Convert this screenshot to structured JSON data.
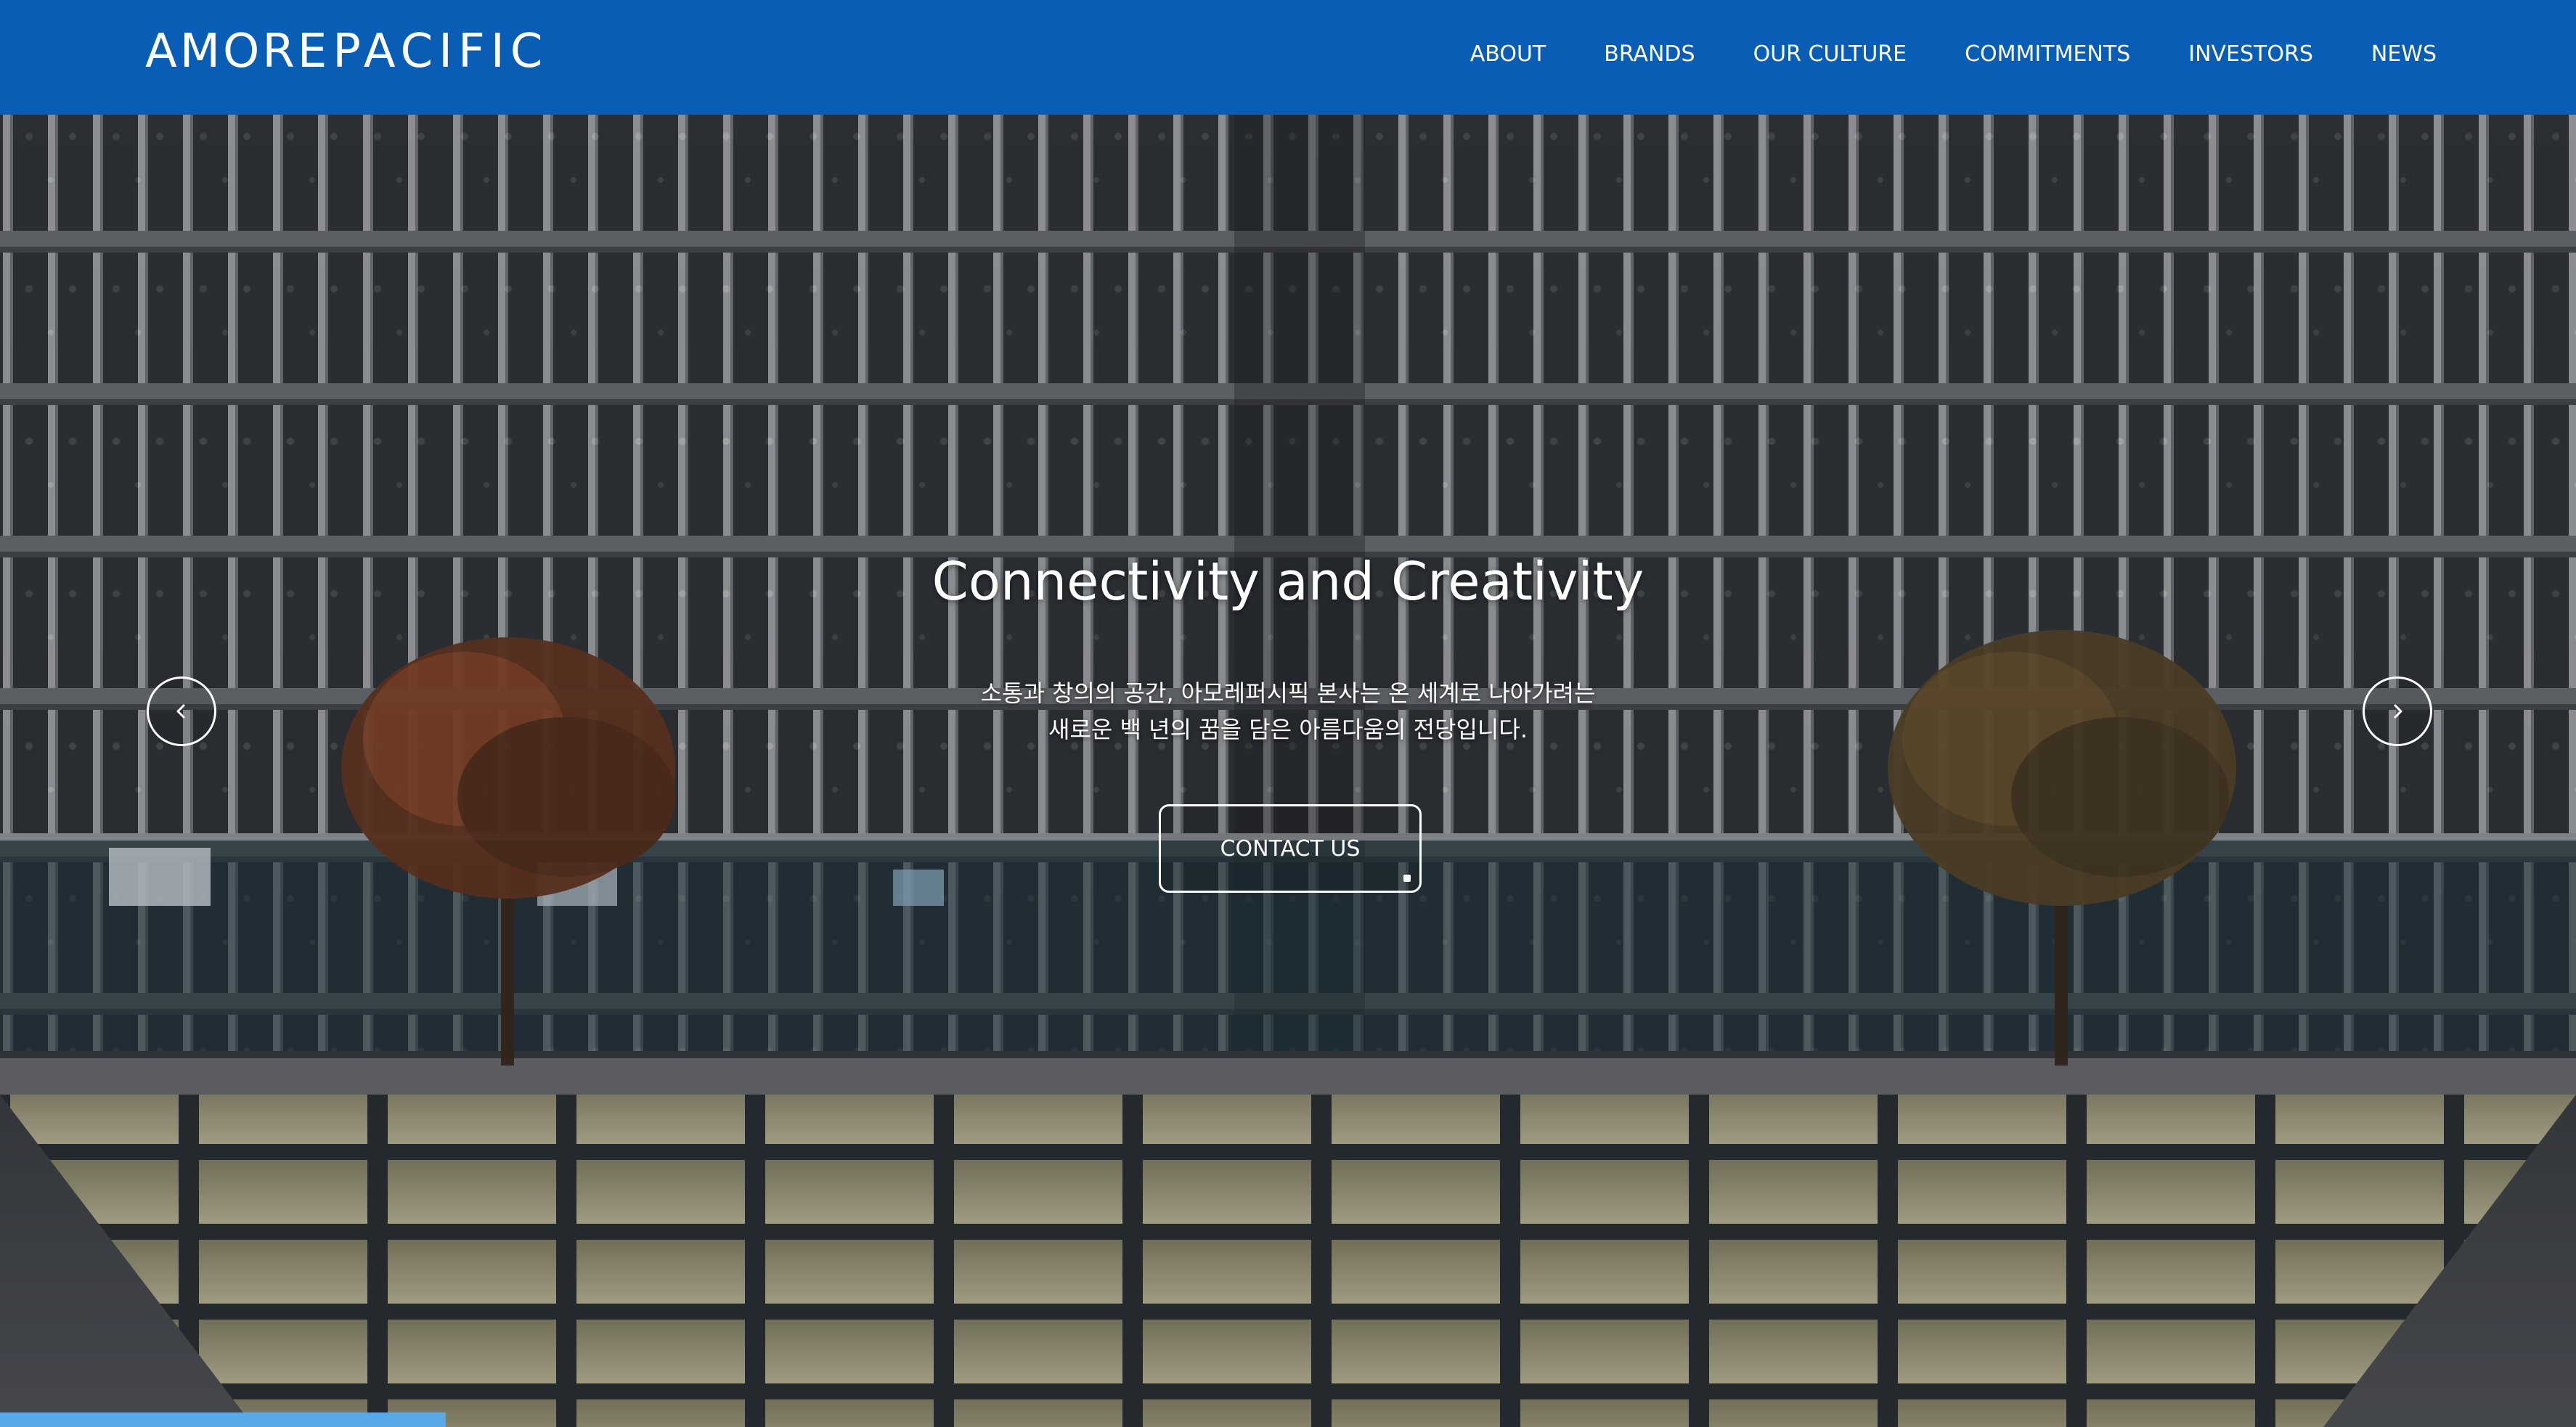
{
  "header": {
    "logo_amore": "AMORE",
    "logo_pacific": "PACIFIC",
    "bg_color": "#0a5db5",
    "nav": [
      {
        "label": "ABOUT"
      },
      {
        "label": "BRANDS"
      },
      {
        "label": "OUR CULTURE"
      },
      {
        "label": "COMMITMENTS"
      },
      {
        "label": "INVESTORS"
      },
      {
        "label": "NEWS"
      }
    ]
  },
  "hero": {
    "title": "Connectivity and Creativity",
    "desc_line1": "소통과 창의의 공간, 아모레퍼시픽 본사는 온 세계로 나아가려는",
    "desc_line2": "새로운 백 년의 꿈을 담은 아름다움의 전당입니다.",
    "cta_label": "CONTACT US",
    "prev_icon": "chevron-left-icon",
    "next_icon": "chevron-right-icon",
    "background_image": "courtyard with glass-floored reflecting pool and illuminated office building facade",
    "slide_progress": 0.173,
    "progress_color": "#5aa9e6"
  }
}
